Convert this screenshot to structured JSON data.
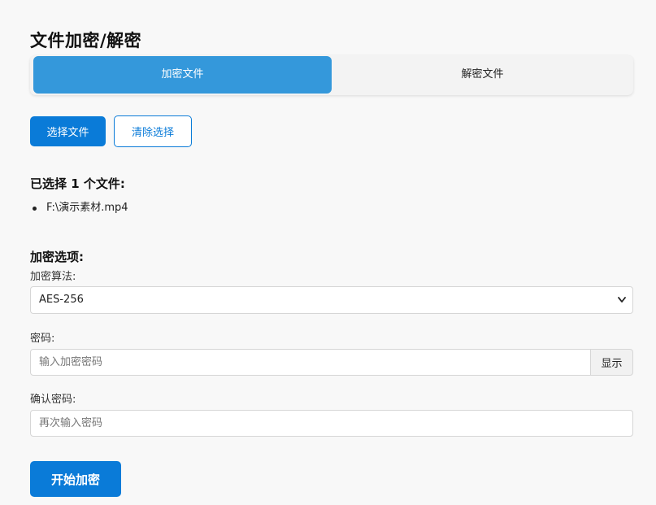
{
  "page": {
    "title": "文件加密/解密"
  },
  "tabs": [
    {
      "label": "加密文件",
      "active": true
    },
    {
      "label": "解密文件",
      "active": false
    }
  ],
  "actions": {
    "select_files": "选择文件",
    "clear_selection": "清除选择"
  },
  "selected": {
    "heading": "已选择 1 个文件:",
    "files": [
      "F:\\演示素材.mp4"
    ]
  },
  "options": {
    "heading": "加密选项:",
    "algorithm_label": "加密算法:",
    "algorithm_value": "AES-256",
    "password_label": "密码:",
    "password_placeholder": "输入加密密码",
    "show_button": "显示",
    "confirm_label": "确认密码:",
    "confirm_placeholder": "再次输入密码"
  },
  "submit": {
    "label": "开始加密"
  },
  "colors": {
    "accent": "#0a7bd8",
    "tab_active": "#3498db",
    "background": "#f8f8f8"
  },
  "icons": {
    "select_chevron": "chevron-down-icon",
    "list_bullet": "bullet-icon"
  }
}
